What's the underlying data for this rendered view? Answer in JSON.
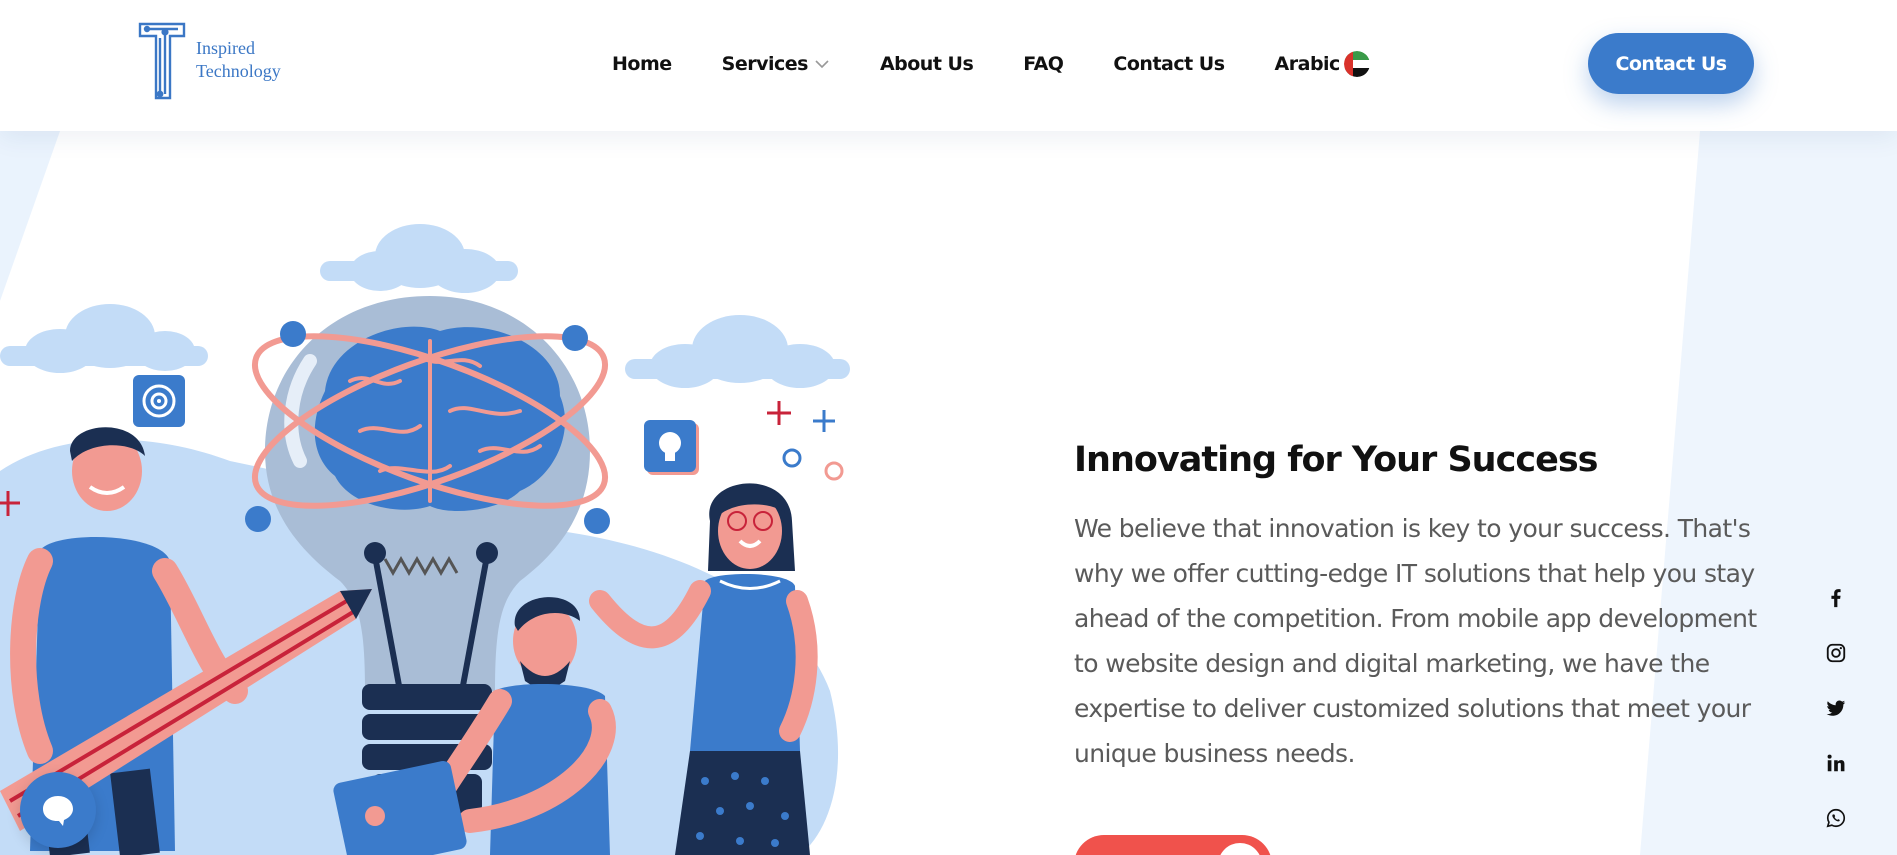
{
  "header": {
    "logo": {
      "line1": "Inspired",
      "line2": "Technology"
    },
    "nav": [
      {
        "label": "Home"
      },
      {
        "label": "Services"
      },
      {
        "label": "About Us"
      },
      {
        "label": "FAQ"
      },
      {
        "label": "Contact Us"
      },
      {
        "label": "Arabic"
      }
    ],
    "cta_label": "Contact Us"
  },
  "hero": {
    "title": "Innovating for Your Success",
    "description": "We believe that innovation is key to your success. That's why we offer cutting-edge IT solutions that help you stay ahead of the competition. From mobile app development to website design and digital marketing, we have the expertise to deliver customized solutions that meet your unique business needs."
  },
  "social": [
    "facebook-icon",
    "instagram-icon",
    "twitter-icon",
    "linkedin-icon",
    "whatsapp-icon"
  ],
  "colors": {
    "primary_blue": "#3b7bcb",
    "accent_red": "#f0524c",
    "light_blue": "#c3dcf7",
    "text_gray": "#5a5a5a"
  }
}
